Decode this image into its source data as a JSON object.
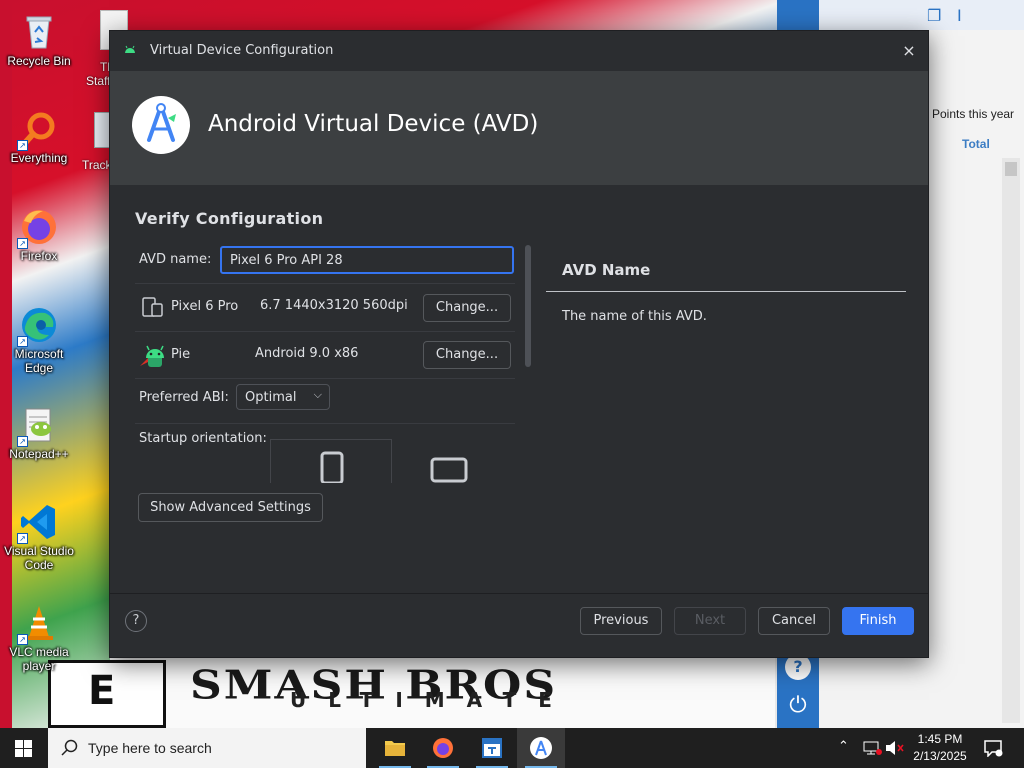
{
  "desktop": {
    "icons": [
      {
        "label": "Recycle Bin"
      },
      {
        "label": "Everything"
      },
      {
        "label": "Firefox"
      },
      {
        "label": "Microsoft Edge"
      },
      {
        "label": "Notepad++"
      },
      {
        "label": "Visual Studio Code"
      },
      {
        "label": "VLC media player"
      }
    ],
    "partial_labels": [
      "Th",
      "Staff",
      "Track"
    ],
    "art_title": "SMASH BROS",
    "art_subtitle": "ULTIMATE",
    "rating": "E"
  },
  "background_app": {
    "column_header": "Points this year",
    "total_label": "Total",
    "help_glyph": "?",
    "power_glyph": "⏻"
  },
  "dialog": {
    "window_title": "Virtual Device Configuration",
    "close_glyph": "×",
    "header_title": "Android Virtual Device (AVD)",
    "section_title": "Verify Configuration",
    "form": {
      "avd_name_label": "AVD name:",
      "avd_name_value": "Pixel 6 Pro API 28",
      "device": {
        "name": "Pixel 6 Pro",
        "spec": "6.7 1440x3120 560dpi",
        "change_label": "Change..."
      },
      "system_image": {
        "name": "Pie",
        "spec": "Android 9.0 x86",
        "change_label": "Change..."
      },
      "abi_label": "Preferred ABI:",
      "abi_value": "Optimal",
      "orientation_label": "Startup orientation:"
    },
    "advanced_button": "Show Advanced Settings",
    "info": {
      "title": "AVD Name",
      "description": "The name of this AVD."
    },
    "footer": {
      "help_glyph": "?",
      "previous_label": "Previous",
      "next_label": "Next",
      "cancel_label": "Cancel",
      "finish_label": "Finish"
    }
  },
  "taskbar": {
    "search_placeholder": "Type here to search",
    "time": "1:45 PM",
    "date": "2/13/2025"
  },
  "colors": {
    "accent": "#3574f0",
    "dialog_bg": "#2b2d30",
    "banner_bg": "#3c3f41",
    "text": "#dfe1e5",
    "android_green": "#3ddc84"
  }
}
